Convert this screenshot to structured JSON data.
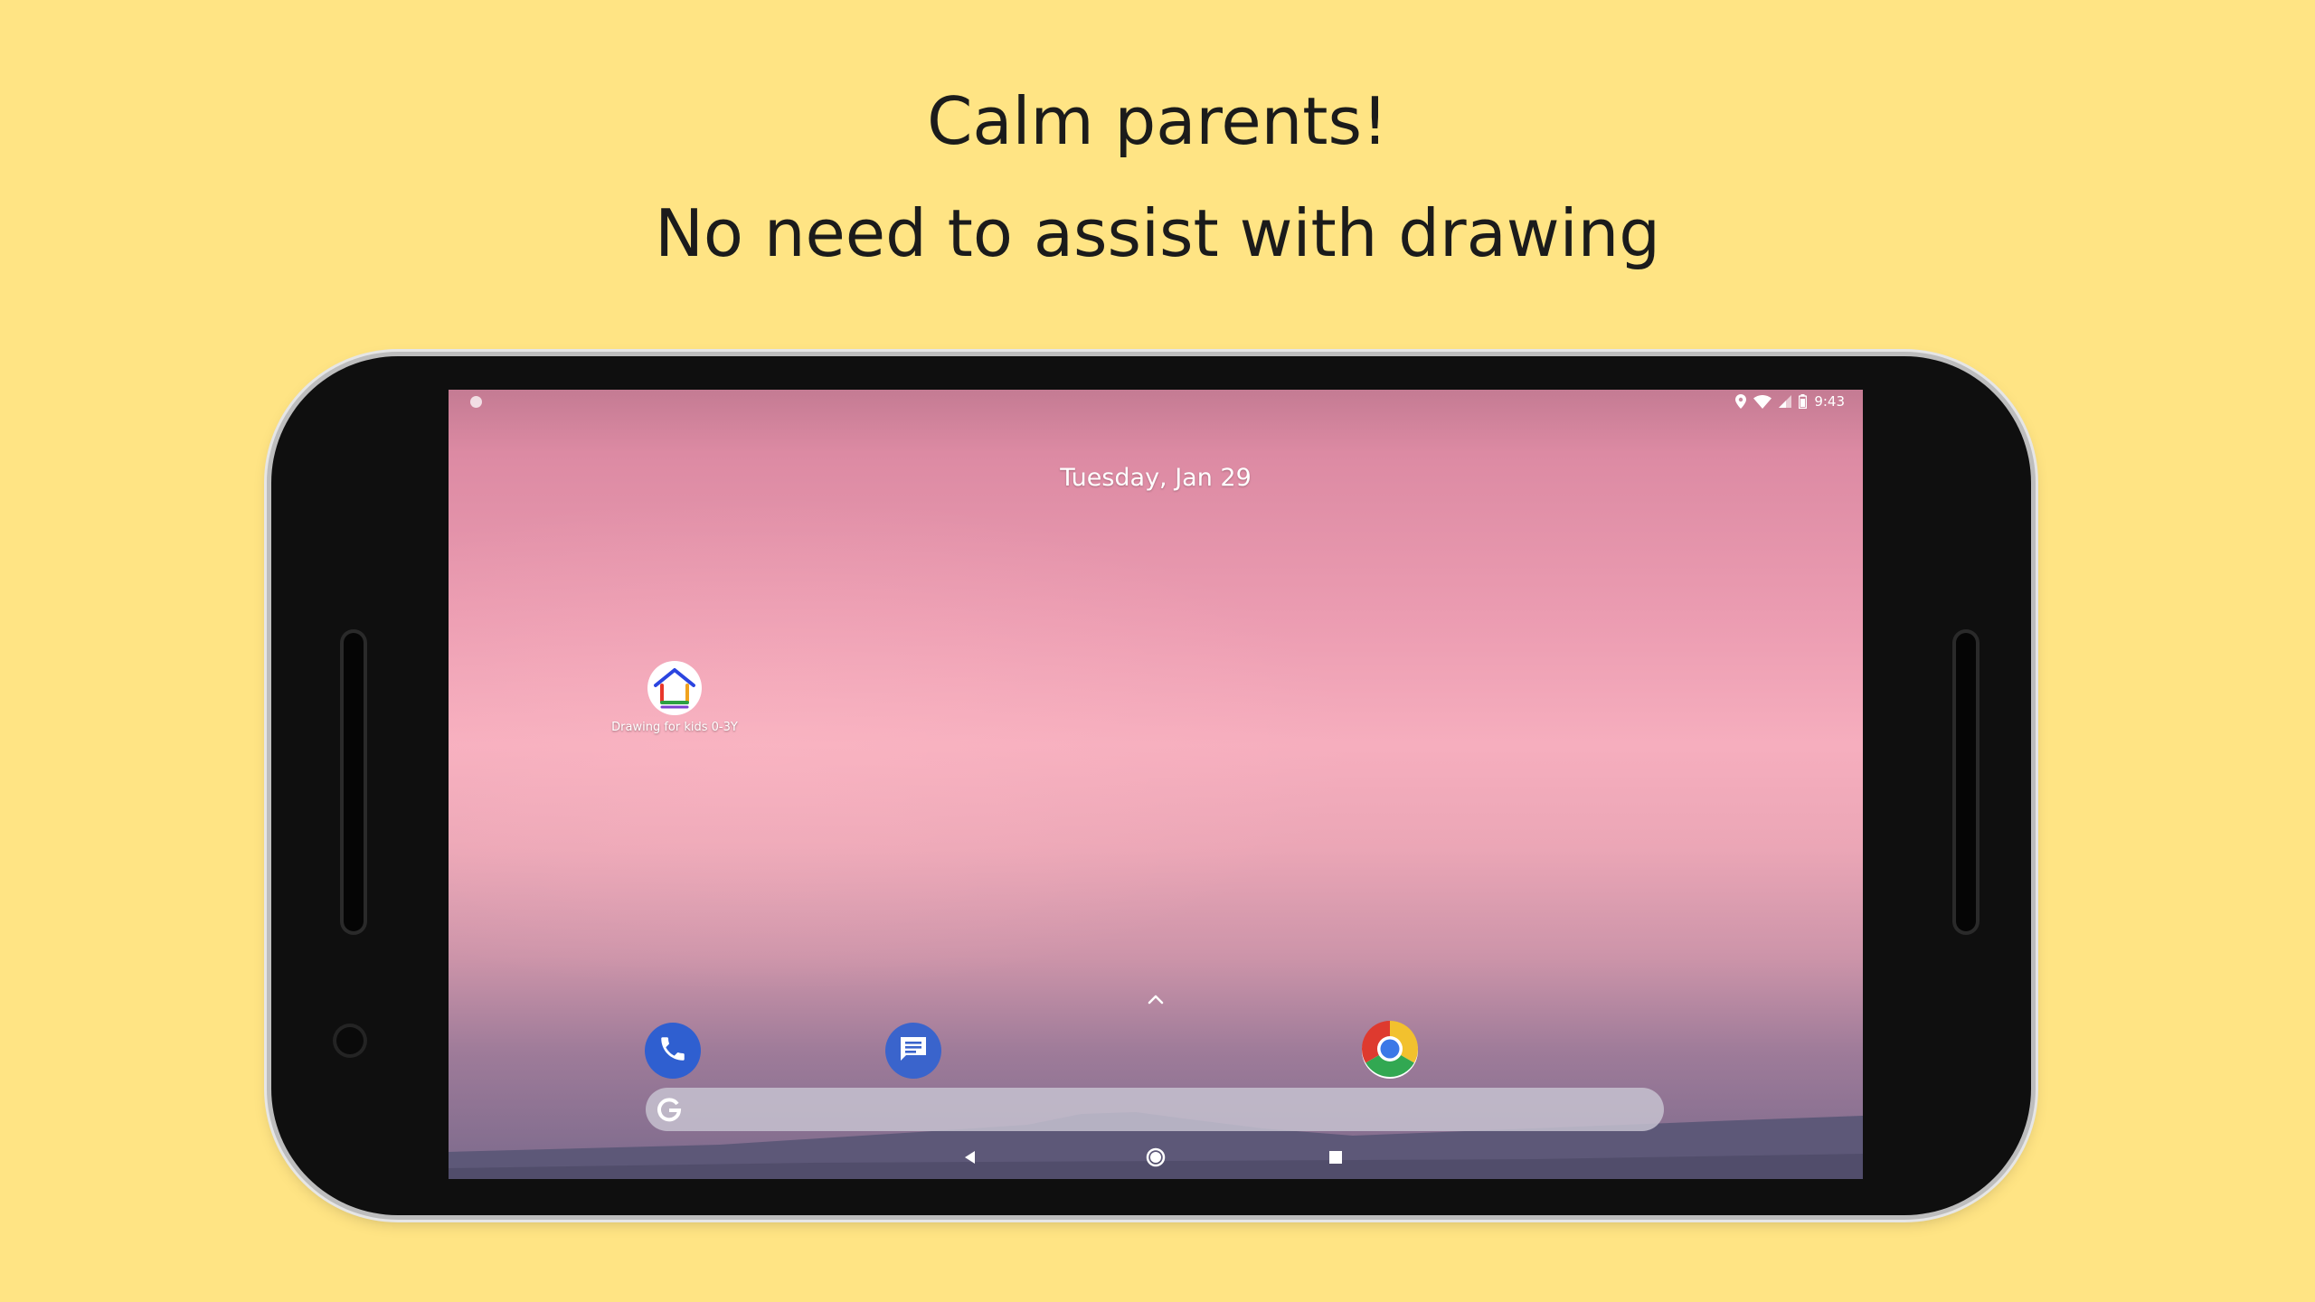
{
  "promo": {
    "headline_line1": "Calm parents!",
    "headline_line2": "No need to assist with drawing"
  },
  "status_bar": {
    "time": "9:43",
    "icons": [
      "location-icon",
      "wifi-icon",
      "signal-icon",
      "battery-icon"
    ]
  },
  "home_screen": {
    "date": "Tuesday, Jan 29",
    "apps": [
      {
        "label": "Drawing for kids 0-3Y",
        "icon": "house-drawing-icon"
      }
    ],
    "dock": [
      {
        "icon": "phone-icon"
      },
      {
        "icon": "messages-icon"
      },
      {
        "icon": "chrome-icon"
      }
    ],
    "search_bar": {
      "icon": "google-g-icon"
    }
  },
  "nav_bar": {
    "buttons": [
      "back-icon",
      "home-icon",
      "recents-icon"
    ]
  },
  "colors": {
    "background": "#ffe484",
    "headline_text": "#1b1b1b",
    "phone_body": "#0f0f0f",
    "phone_dial_blue": "#2f5fd0"
  }
}
